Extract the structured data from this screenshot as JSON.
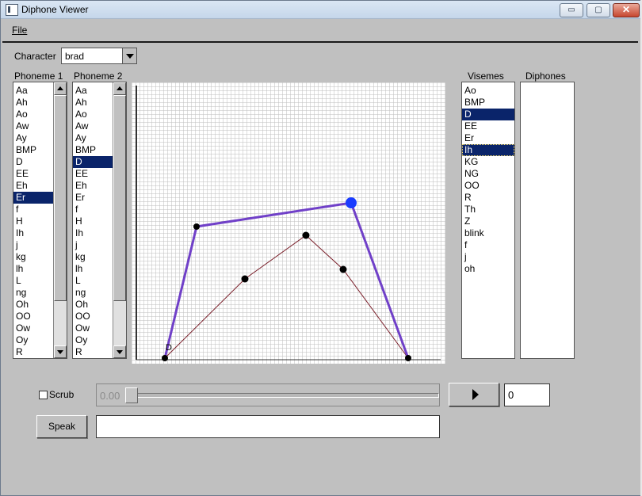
{
  "window": {
    "title": "Diphone Viewer",
    "controls": {
      "minimize": "▭",
      "maximize": "▢",
      "close": "✕"
    }
  },
  "menu": {
    "file": "File"
  },
  "character": {
    "label": "Character",
    "value": "brad"
  },
  "phoneme1": {
    "label": "Phoneme 1",
    "items": [
      "Aa",
      "Ah",
      "Ao",
      "Aw",
      "Ay",
      "BMP",
      "D",
      "EE",
      "Eh",
      "Er",
      "f",
      "H",
      "Ih",
      "j",
      "kg",
      "lh",
      "L",
      "ng",
      "Oh",
      "OO",
      "Ow",
      "Oy",
      "R"
    ],
    "selected": "Er"
  },
  "phoneme2": {
    "label": "Phoneme 2",
    "items": [
      "Aa",
      "Ah",
      "Ao",
      "Aw",
      "Ay",
      "BMP",
      "D",
      "EE",
      "Eh",
      "Er",
      "f",
      "H",
      "Ih",
      "j",
      "kg",
      "lh",
      "L",
      "ng",
      "Oh",
      "OO",
      "Ow",
      "Oy",
      "R"
    ],
    "selected": "D"
  },
  "visemes": {
    "label": "Visemes",
    "items": [
      "Ao",
      "BMP",
      "D",
      "EE",
      "Er",
      "Ih",
      "KG",
      "NG",
      "OO",
      "R",
      "Th",
      "Z",
      "blink",
      "f",
      "j",
      "oh"
    ],
    "selected": [
      "D",
      "Ih"
    ]
  },
  "diphones": {
    "label": "Diphones",
    "items": []
  },
  "curve_editor": {
    "point_marker": "D",
    "colors": {
      "purple_curve": "#7040c8",
      "thin_curve": "#7a1f2a",
      "active_point": "#1a3cff",
      "grid": "#c8c8c8"
    }
  },
  "scrub": {
    "label": "Scrub",
    "checked": false,
    "value": "0.00",
    "position": 0
  },
  "play": {
    "icon": "play-icon",
    "frame": "0"
  },
  "speak": {
    "label": "Speak",
    "text": ""
  }
}
